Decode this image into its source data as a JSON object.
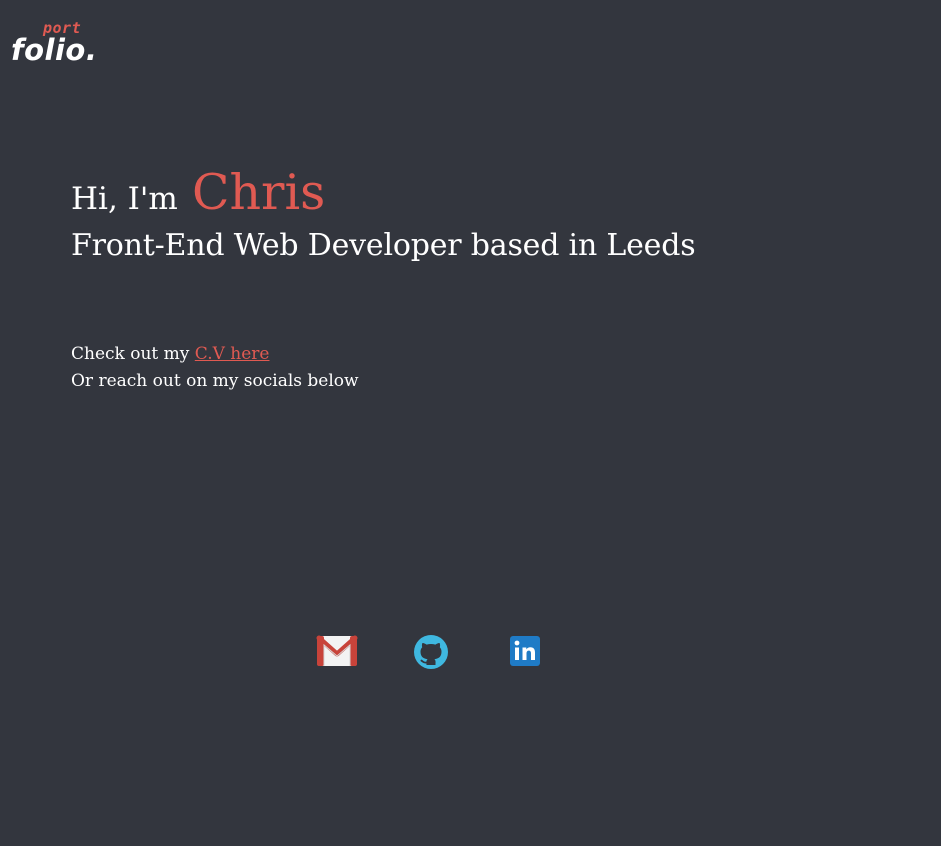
{
  "logo": {
    "top_text": "port",
    "bottom_text": "folio."
  },
  "hero": {
    "greeting_prefix": "Hi, I'm",
    "name": "Chris",
    "subtitle": "Front-End Web Developer based in Leeds"
  },
  "contact": {
    "cv_prefix": "Check out my",
    "cv_link_label": "C.V here",
    "socials_text": "Or reach out on my socials below"
  },
  "socials": [
    {
      "name": "Gmail",
      "icon": "gmail-icon"
    },
    {
      "name": "GitHub",
      "icon": "github-icon"
    },
    {
      "name": "LinkedIn",
      "icon": "linkedin-icon"
    }
  ],
  "colors": {
    "background": "#33363e",
    "accent": "#e05a52",
    "text": "#ffffff",
    "github_blue": "#3fb8e0",
    "linkedin_blue": "#1f7bc6",
    "gmail_red": "#c8433a"
  }
}
